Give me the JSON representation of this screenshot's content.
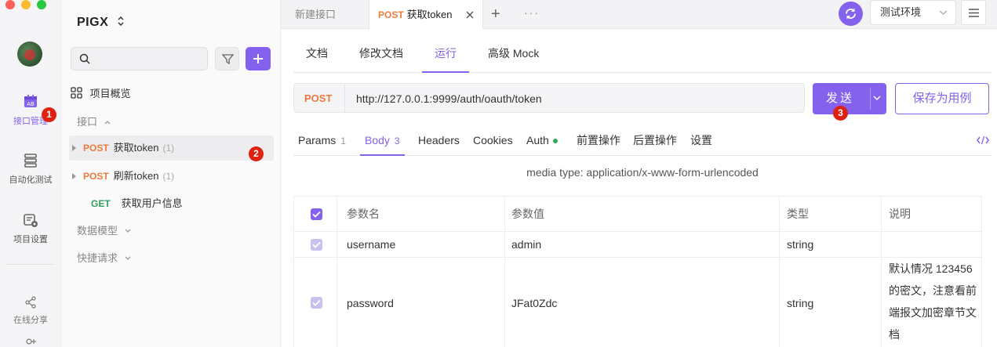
{
  "rail": {
    "items": [
      {
        "label": "接口管理",
        "icon": "api-icon"
      },
      {
        "label": "自动化测试",
        "icon": "automation-icon"
      },
      {
        "label": "项目设置",
        "icon": "project-settings-icon"
      },
      {
        "label": "在线分享",
        "icon": "share-icon"
      }
    ],
    "active_color": "#8462ed"
  },
  "badges": {
    "b1": "1",
    "b2": "2",
    "b3": "3"
  },
  "project": {
    "title": "PIGX"
  },
  "tree": {
    "overview": "项目概览",
    "group_api": "接口",
    "items": [
      {
        "method": "POST",
        "name": "获取token",
        "count": "(1)"
      },
      {
        "method": "POST",
        "name": "刷新token",
        "count": "(1)"
      },
      {
        "method": "GET",
        "name": "获取用户信息"
      }
    ],
    "group_models": "数据模型",
    "group_quick": "快捷请求"
  },
  "tabs": {
    "new_tab": "新建接口",
    "active_method": "POST",
    "active_name": "获取token",
    "plus": "+",
    "more": "···"
  },
  "env": {
    "selected": "测试环境"
  },
  "subtabs": [
    "文档",
    "修改文档",
    "运行",
    "高级 Mock"
  ],
  "request": {
    "method": "POST",
    "url": "http://127.0.0.1:9999/auth/oauth/token",
    "send_label": "发送",
    "save_label": "保存为用例"
  },
  "reqtabs": {
    "params": "Params",
    "params_count": "1",
    "body": "Body",
    "body_count": "3",
    "headers": "Headers",
    "cookies": "Cookies",
    "auth": "Auth",
    "pre": "前置操作",
    "post": "后置操作",
    "settings": "设置"
  },
  "media_type": "media type: application/x-www-form-urlencoded",
  "params_table": {
    "headers": [
      "参数名",
      "参数值",
      "类型",
      "说明"
    ],
    "rows": [
      {
        "name": "username",
        "value": "admin",
        "type": "string",
        "desc": ""
      },
      {
        "name": "password",
        "value": "JFat0Zdc",
        "type": "string",
        "desc_lines": [
          "默认情况 123456",
          "的密文，注意看前",
          "端报文加密章节文",
          "档"
        ]
      }
    ]
  },
  "colors": {
    "accent": "#8462ed",
    "post": "#ec7a3c",
    "get": "#2f9e5c",
    "badge": "#dd2211"
  }
}
